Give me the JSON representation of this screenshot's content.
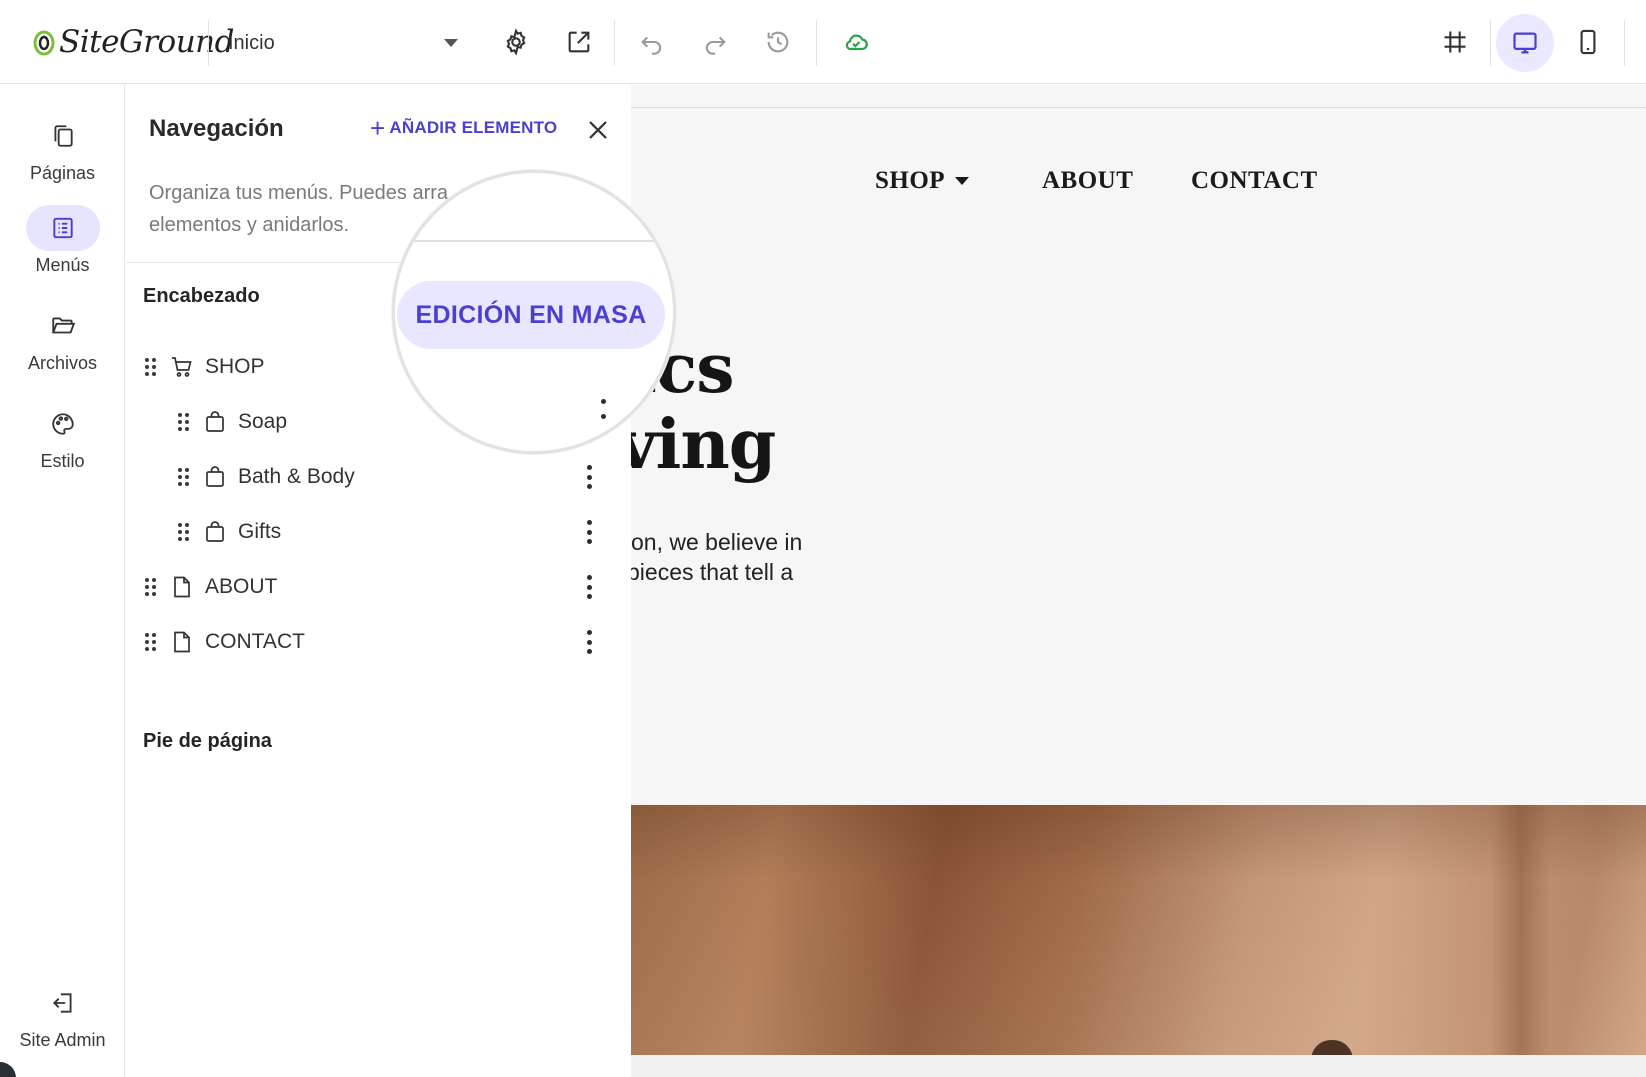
{
  "brand": {
    "name": "SiteGround",
    "accent": "#4a3fd1",
    "accent_light": "#e9e6ff",
    "green": "#2aa14a"
  },
  "topbar": {
    "page_select": {
      "value": "Inicio"
    },
    "icons": [
      "gear-icon",
      "external-link-icon",
      "undo-icon",
      "redo-icon",
      "history-icon",
      "cloud-check-icon",
      "grid-icon",
      "desktop-icon",
      "mobile-icon"
    ],
    "active_view": "desktop"
  },
  "rail": {
    "items": [
      {
        "label": "Páginas",
        "icon": "pages-icon"
      },
      {
        "label": "Menús",
        "icon": "menus-icon",
        "active": true
      },
      {
        "label": "Archivos",
        "icon": "folder-icon"
      },
      {
        "label": "Estilo",
        "icon": "palette-icon"
      }
    ],
    "bottom": {
      "label": "Site Admin",
      "icon": "exit-icon"
    }
  },
  "panel": {
    "title": "Navegación",
    "add_label": "AÑADIR ELEMENTO",
    "description": "Organiza tus menús. Puedes arra elementos y anidarlos.",
    "description_line1": "Organiza tus menús. Puedes arra",
    "description_line2": "elementos y anidarlos.",
    "bulk_edit_label": "EDICIÓN EN MASA",
    "header_section": "Encabezado",
    "footer_section": "Pie de página",
    "menu_items": [
      {
        "label": "SHOP",
        "icon": "cart-icon",
        "level": 0
      },
      {
        "label": "Soap",
        "icon": "bag-icon",
        "level": 1
      },
      {
        "label": "Bath & Body",
        "icon": "bag-icon",
        "level": 1
      },
      {
        "label": "Gifts",
        "icon": "bag-icon",
        "level": 1
      },
      {
        "label": "ABOUT",
        "icon": "page-icon",
        "level": 0
      },
      {
        "label": "CONTACT",
        "icon": "page-icon",
        "level": 0
      }
    ]
  },
  "preview": {
    "nav": [
      "SHOP",
      "ABOUT",
      "CONTACT"
    ],
    "hero_line1": "ics",
    "hero_line2": "ving",
    "hero_p1": "on, we believe in",
    "hero_p2": "pieces that tell a"
  }
}
